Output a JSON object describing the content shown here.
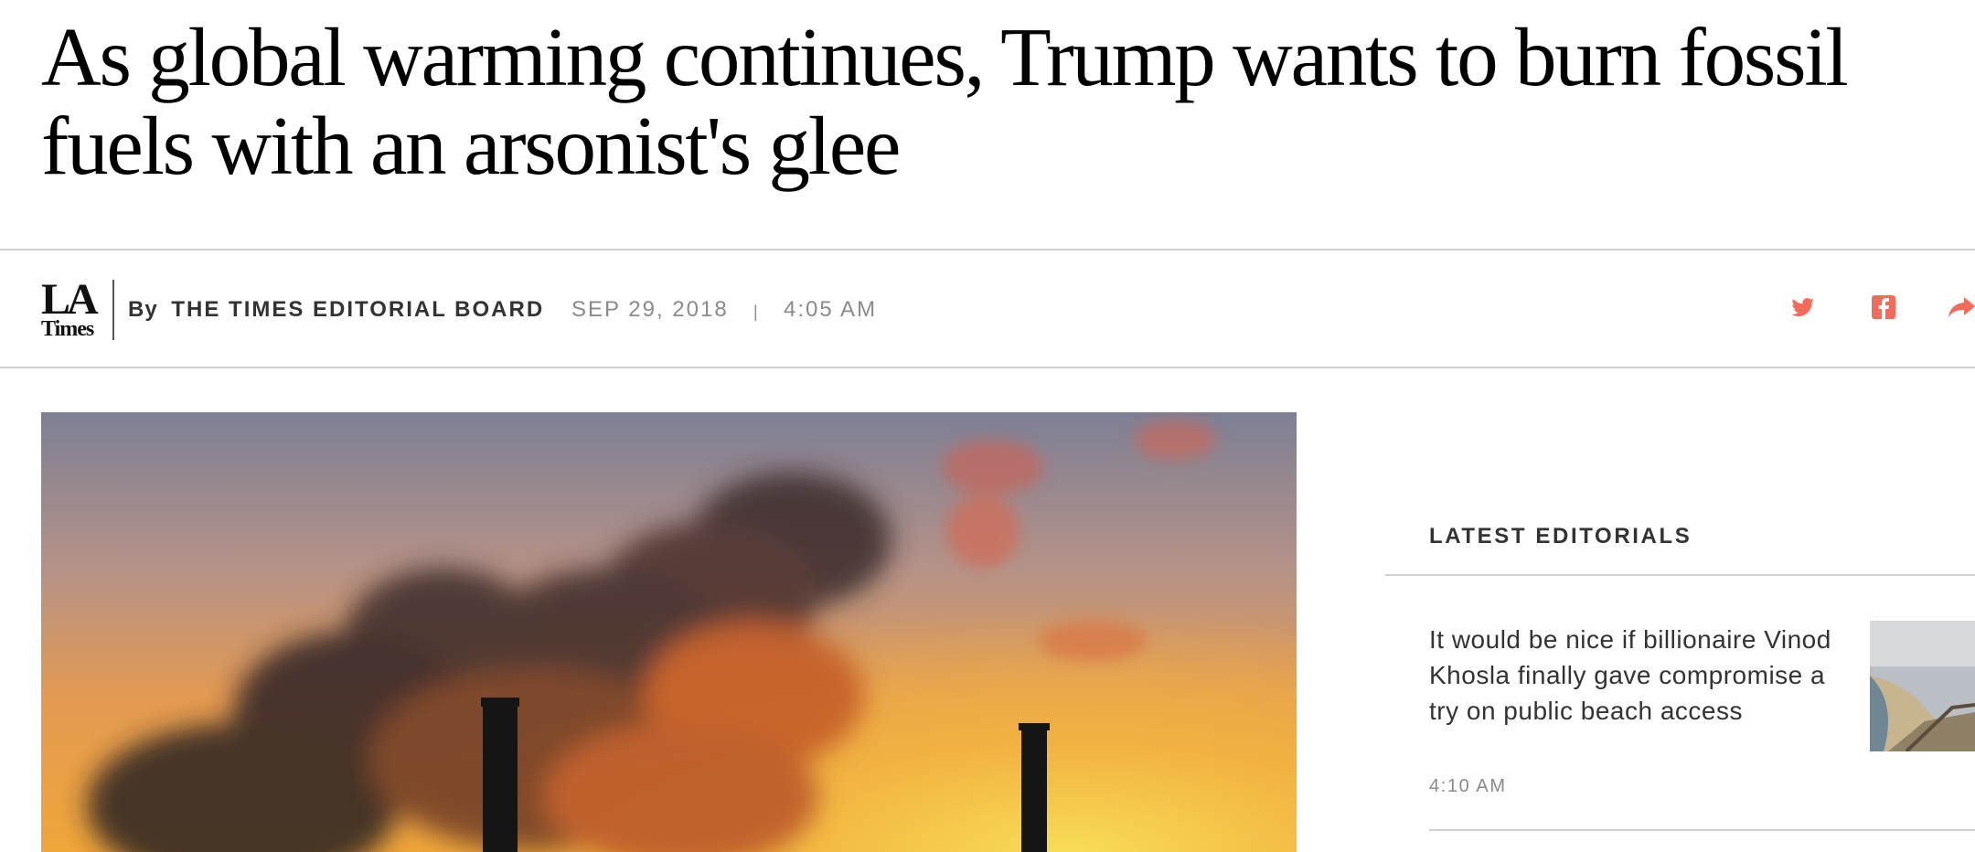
{
  "article": {
    "headline": "As global warming continues, Trump wants to burn fossil fuels with an arsonist's glee"
  },
  "byline": {
    "logo": {
      "line1": "LA",
      "line2": "Times"
    },
    "by_prefix": "By",
    "author": "THE TIMES EDITORIAL BOARD",
    "date": "SEP 29, 2018",
    "separator": "|",
    "time": "4:05 AM"
  },
  "share": {
    "icons": [
      "twitter-icon",
      "facebook-icon",
      "share-arrow-icon"
    ],
    "color": "#f26b5b"
  },
  "hero_image": {
    "subject": "smokestacks-at-sunset"
  },
  "sidebar": {
    "section_title": "LATEST EDITORIALS",
    "items": [
      {
        "title": "It would be nice if billionaire Vinod Khosla finally gave compromise a try on public beach access",
        "time": "4:10 AM"
      }
    ]
  }
}
